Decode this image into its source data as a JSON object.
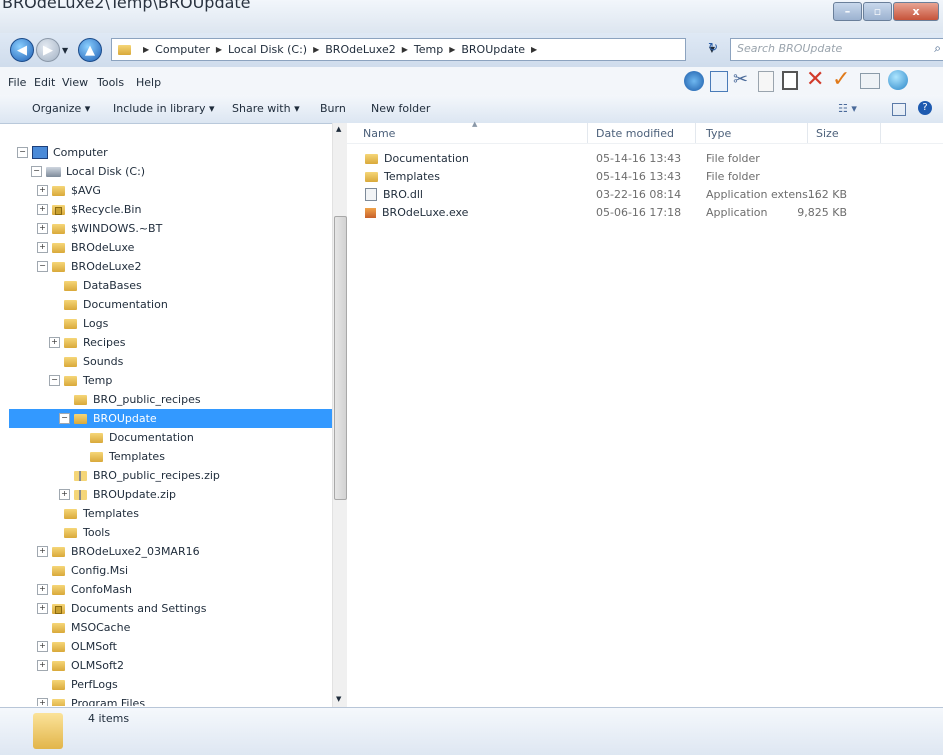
{
  "window": {
    "title": "BROdeLuxe2\\Temp\\BROUpdate",
    "min": "–",
    "max": "▫",
    "close": "x"
  },
  "address": {
    "crumbs": [
      "Computer",
      "Local Disk (C:)",
      "BROdeLuxe2",
      "Temp",
      "BROUpdate"
    ]
  },
  "search": {
    "placeholder": "Search BROUpdate"
  },
  "menu": {
    "file": "File",
    "edit": "Edit",
    "view": "View",
    "tools": "Tools",
    "help": "Help"
  },
  "commands": {
    "organize": "Organize ▾",
    "include": "Include in library ▾",
    "share": "Share with ▾",
    "burn": "Burn",
    "new_folder": "New folder"
  },
  "tree": [
    {
      "label": "Computer",
      "depth": 0,
      "exp": "−",
      "icon": "computer"
    },
    {
      "label": "Local Disk (C:)",
      "depth": 1,
      "exp": "−",
      "icon": "drive"
    },
    {
      "label": "$AVG",
      "depth": 2,
      "exp": "+",
      "icon": "folder"
    },
    {
      "label": "$Recycle.Bin",
      "depth": 2,
      "exp": "+",
      "icon": "lock"
    },
    {
      "label": "$WINDOWS.~BT",
      "depth": 2,
      "exp": "+",
      "icon": "folder"
    },
    {
      "label": "BROdeLuxe",
      "depth": 2,
      "exp": "+",
      "icon": "folder"
    },
    {
      "label": "BROdeLuxe2",
      "depth": 2,
      "exp": "−",
      "icon": "folder"
    },
    {
      "label": "DataBases",
      "depth": 3,
      "exp": "",
      "icon": "folder"
    },
    {
      "label": "Documentation",
      "depth": 3,
      "exp": "",
      "icon": "folder"
    },
    {
      "label": "Logs",
      "depth": 3,
      "exp": "",
      "icon": "folder"
    },
    {
      "label": "Recipes",
      "depth": 3,
      "exp": "+",
      "icon": "folder"
    },
    {
      "label": "Sounds",
      "depth": 3,
      "exp": "",
      "icon": "folder"
    },
    {
      "label": "Temp",
      "depth": 3,
      "exp": "−",
      "icon": "folder"
    },
    {
      "label": "BRO_public_recipes",
      "depth": 4,
      "exp": "",
      "icon": "folder"
    },
    {
      "label": "BROUpdate",
      "depth": 4,
      "exp": "−",
      "icon": "folder",
      "selected": true
    },
    {
      "label": "Documentation",
      "depth": 5,
      "exp": "",
      "icon": "folder"
    },
    {
      "label": "Templates",
      "depth": 5,
      "exp": "",
      "icon": "folder"
    },
    {
      "label": "BRO_public_recipes.zip",
      "depth": 4,
      "exp": "",
      "icon": "zip"
    },
    {
      "label": "BROUpdate.zip",
      "depth": 4,
      "exp": "+",
      "icon": "zip"
    },
    {
      "label": "Templates",
      "depth": 3,
      "exp": "",
      "icon": "folder"
    },
    {
      "label": "Tools",
      "depth": 3,
      "exp": "",
      "icon": "folder"
    },
    {
      "label": "BROdeLuxe2_03MAR16",
      "depth": 2,
      "exp": "+",
      "icon": "folder"
    },
    {
      "label": "Config.Msi",
      "depth": 2,
      "exp": "",
      "icon": "folder"
    },
    {
      "label": "ConfoMash",
      "depth": 2,
      "exp": "+",
      "icon": "folder"
    },
    {
      "label": "Documents and Settings",
      "depth": 2,
      "exp": "+",
      "icon": "lock"
    },
    {
      "label": "MSOCache",
      "depth": 2,
      "exp": "",
      "icon": "folder"
    },
    {
      "label": "OLMSoft",
      "depth": 2,
      "exp": "+",
      "icon": "folder"
    },
    {
      "label": "OLMSoft2",
      "depth": 2,
      "exp": "+",
      "icon": "folder"
    },
    {
      "label": "PerfLogs",
      "depth": 2,
      "exp": "",
      "icon": "folder"
    },
    {
      "label": "Program Files",
      "depth": 2,
      "exp": "+",
      "icon": "folder"
    }
  ],
  "columns": {
    "name": "Name",
    "date": "Date modified",
    "type": "Type",
    "size": "Size"
  },
  "files": [
    {
      "name": "Documentation",
      "date": "05-14-16 13:43",
      "type": "File folder",
      "size": "",
      "icon": "folder"
    },
    {
      "name": "Templates",
      "date": "05-14-16 13:43",
      "type": "File folder",
      "size": "",
      "icon": "folder"
    },
    {
      "name": "BRO.dll",
      "date": "03-22-16 08:14",
      "type": "Application extens...",
      "size": "162 KB",
      "icon": "dll"
    },
    {
      "name": "BROdeLuxe.exe",
      "date": "05-06-16 17:18",
      "type": "Application",
      "size": "9,825 KB",
      "icon": "exe"
    }
  ],
  "status": {
    "count": "4 items"
  }
}
